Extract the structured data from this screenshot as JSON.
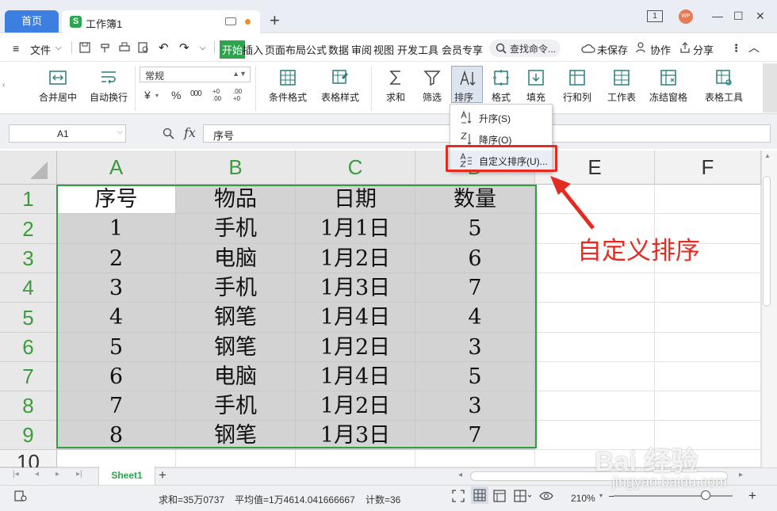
{
  "titlebar": {
    "home_tab": "首页",
    "workbook_tab": "工作簿1",
    "workbook_icon": "S",
    "new_tab": "+",
    "page_count": "1",
    "avatar": "WP",
    "minimize": "—",
    "maximize": "☐",
    "close": "✕"
  },
  "menubar": {
    "file": "文件",
    "items": [
      "开始",
      "插入",
      "页面布局",
      "公式",
      "数据",
      "审阅",
      "视图",
      "开发工具",
      "会员专享"
    ],
    "active_item": "开始",
    "search_placeholder": "查找命令...",
    "unsaved": "未保存",
    "collab": "协作",
    "share": "分享"
  },
  "ribbon": {
    "merge_center": "合并居中",
    "wrap_text": "自动换行",
    "number_format": "常规",
    "currency": "¥",
    "percent": "%",
    "thousands": "000",
    "dec_inc": "+0 .00",
    "dec_dec": ".00 +0",
    "cond_format": "条件格式",
    "table_style": "表格样式",
    "sum": "求和",
    "filter": "筛选",
    "sort": "排序",
    "format": "格式",
    "fill": "填充",
    "rows_cols": "行和列",
    "worksheet": "工作表",
    "freeze": "冻结窗格",
    "table_tools": "表格工具"
  },
  "formula_bar": {
    "name_box": "A1",
    "fx": "fx",
    "content": "序号"
  },
  "sort_menu": {
    "ascending": "升序(S)",
    "descending": "降序(O)",
    "custom": "自定义排序(U)..."
  },
  "annotation": "自定义排序",
  "columns": [
    "A",
    "B",
    "C",
    "D",
    "E",
    "F"
  ],
  "row_numbers": [
    "1",
    "2",
    "3",
    "4",
    "5",
    "6",
    "7",
    "8",
    "9",
    "10"
  ],
  "table": {
    "headers": [
      "序号",
      "物品",
      "日期",
      "数量"
    ],
    "rows": [
      [
        "1",
        "手机",
        "1月1日",
        "5"
      ],
      [
        "2",
        "电脑",
        "1月2日",
        "6"
      ],
      [
        "3",
        "手机",
        "1月3日",
        "7"
      ],
      [
        "4",
        "钢笔",
        "1月4日",
        "4"
      ],
      [
        "5",
        "钢笔",
        "1月2日",
        "3"
      ],
      [
        "6",
        "电脑",
        "1月4日",
        "5"
      ],
      [
        "7",
        "手机",
        "1月2日",
        "3"
      ],
      [
        "8",
        "钢笔",
        "1月3日",
        "7"
      ]
    ]
  },
  "sheets": {
    "active": "Sheet1",
    "add": "+"
  },
  "statusbar": {
    "sum": "求和=35万0737",
    "average": "平均值=1万4614.041666667",
    "count": "计数=36",
    "zoom": "210%",
    "zoom_out": "—",
    "zoom_in": "+"
  },
  "watermark": {
    "brand": "Bai 经验",
    "url": "jingyan.baidu.com"
  },
  "colors": {
    "accent_green": "#2da44e",
    "accent_blue": "#3d7fe0",
    "annotation_red": "#e52a22"
  }
}
